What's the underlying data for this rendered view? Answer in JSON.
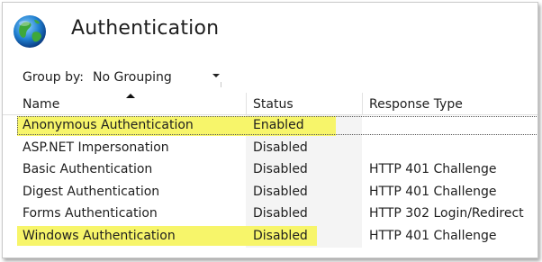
{
  "window": {
    "title": "Authentication",
    "icon": "globe-icon"
  },
  "group_by": {
    "label": "Group by:",
    "value": "No Grouping"
  },
  "columns": [
    {
      "label": "Name",
      "sorted": "ascending"
    },
    {
      "label": "Status"
    },
    {
      "label": "Response Type"
    }
  ],
  "rows": [
    {
      "name": "Anonymous Authentication",
      "status": "Enabled",
      "response_type": "",
      "highlighted": true,
      "selected": true
    },
    {
      "name": "ASP.NET Impersonation",
      "status": "Disabled",
      "response_type": "",
      "highlighted": false
    },
    {
      "name": "Basic Authentication",
      "status": "Disabled",
      "response_type": "HTTP 401 Challenge",
      "highlighted": false
    },
    {
      "name": "Digest Authentication",
      "status": "Disabled",
      "response_type": "HTTP 401 Challenge",
      "highlighted": false
    },
    {
      "name": "Forms Authentication",
      "status": "Disabled",
      "response_type": "HTTP 302 Login/Redirect",
      "highlighted": false
    },
    {
      "name": "Windows Authentication",
      "status": "Disabled",
      "response_type": "HTTP 401 Challenge",
      "highlighted": true
    }
  ],
  "colors": {
    "highlight": "#f7f56a",
    "status_column_bg": "#f4f4f4"
  }
}
